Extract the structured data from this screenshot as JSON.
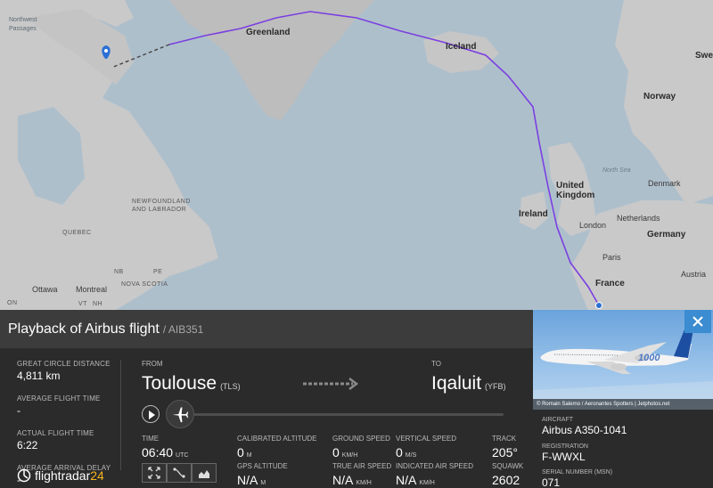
{
  "map": {
    "labels": {
      "northwest_passages": "Northwest\nPassages",
      "greenland": "Greenland",
      "iceland": "Iceland",
      "norway": "Norway",
      "sweden": "Swe",
      "north_sea": "North Sea",
      "denmark": "Denmark",
      "united_kingdom": "United\nKingdom",
      "ireland": "Ireland",
      "london": "London",
      "netherlands": "Netherlands",
      "germany": "Germany",
      "paris": "Paris",
      "france": "France",
      "austria": "Austria",
      "newfoundland": "NEWFOUNDLAND\nAND LABRADOR",
      "quebec": "QUEBEC",
      "ottawa": "Ottawa",
      "montreal": "Montreal",
      "nova_scotia": "NOVA SCOTIA",
      "nb": "NB",
      "pe": "PE",
      "vt": "VT",
      "nh": "NH",
      "on": "ON"
    },
    "colors": {
      "water": "#aebfcc",
      "land": "#c9c9c9",
      "greenland": "#b9b9b9",
      "route": "#7b3fe0"
    }
  },
  "panel": {
    "title": "Playback of Airbus flight",
    "flight_code": "/ AIB351",
    "stats": [
      {
        "label": "GREAT CIRCLE DISTANCE",
        "value": "4,811 km"
      },
      {
        "label": "AVERAGE FLIGHT TIME",
        "value": "-"
      },
      {
        "label": "ACTUAL FLIGHT TIME",
        "value": "6:22"
      },
      {
        "label": "AVERAGE ARRIVAL DELAY",
        "value": "-"
      }
    ],
    "from_label": "FROM",
    "from_city": "Toulouse",
    "from_code": "(TLS)",
    "to_label": "TO",
    "to_city": "Iqaluit",
    "to_code": "(YFB)",
    "metrics": {
      "time_label": "TIME",
      "time_value": "06:40",
      "time_unit": "UTC",
      "cal_alt_label": "CALIBRATED ALTITUDE",
      "cal_alt_value": "0",
      "cal_alt_unit": "M",
      "gps_alt_label": "GPS ALTITUDE",
      "gps_alt_value": "N/A",
      "gps_alt_unit": "M",
      "ground_speed_label": "GROUND SPEED",
      "ground_speed_value": "0",
      "ground_speed_unit": "KM/H",
      "tas_label": "TRUE AIR SPEED",
      "tas_value": "N/A",
      "tas_unit": "KM/H",
      "vspeed_label": "VERTICAL SPEED",
      "vspeed_value": "0",
      "vspeed_unit": "M/S",
      "ias_label": "INDICATED AIR SPEED",
      "ias_value": "N/A",
      "ias_unit": "KM/H",
      "track_label": "TRACK",
      "track_value": "205°",
      "squawk_label": "SQUAWK",
      "squawk_value": "2602"
    },
    "logo_text_main": "flightradar",
    "logo_text_accent": "24"
  },
  "aircraft": {
    "photo_credit": "© Romain Salerno / Aeronantes Spotters | Jetphotos.net",
    "aircraft_label": "AIRCRAFT",
    "aircraft_value": "Airbus A350-1041",
    "registration_label": "REGISTRATION",
    "registration_value": "F-WWXL",
    "serial_label": "SERIAL NUMBER (MSN)",
    "serial_value": "071",
    "livery_text": "1000"
  }
}
